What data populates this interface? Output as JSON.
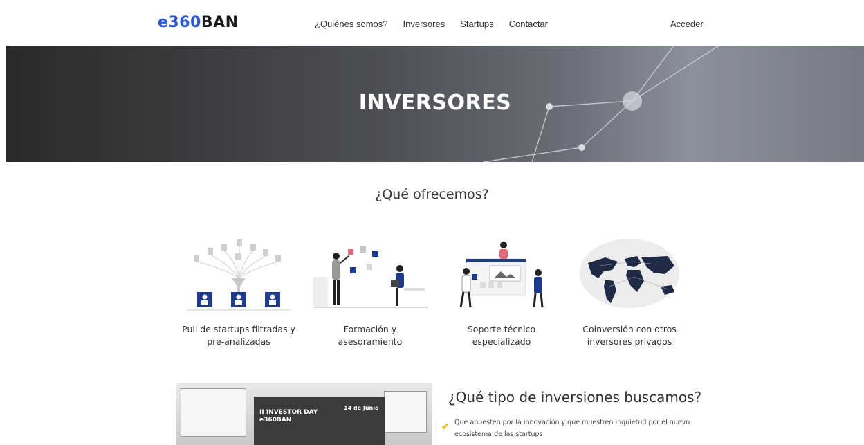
{
  "header": {
    "logo_part1": "e360",
    "logo_part2": "BAN",
    "nav": [
      "¿Quiénes somos?",
      "Inversores",
      "Startups",
      "Contactar"
    ],
    "login": "Acceder"
  },
  "hero": {
    "title": "INVERSORES"
  },
  "offer": {
    "title": "¿Qué ofrecemos?",
    "features": [
      {
        "caption_line1": "Pull de startups filtradas y",
        "caption_line2": "pre-analizadas",
        "icon": "startup-funnel-icon"
      },
      {
        "caption_line1": "Formación y",
        "caption_line2": "asesoramiento",
        "icon": "training-icon"
      },
      {
        "caption_line1": "Soporte técnico",
        "caption_line2": "especializado",
        "icon": "support-icon"
      },
      {
        "caption_line1": "Coinversión con otros",
        "caption_line2": "inversores privados",
        "icon": "world-map-icon"
      }
    ]
  },
  "investments": {
    "title": "¿Qué tipo de inversiones buscamos?",
    "items": [
      "Que apuesten por la innovación y que muestren inquietud por el nuevo ecosistema de las startups"
    ],
    "event_title_line1": "II INVESTOR DAY",
    "event_title_line2": "e360BAN",
    "event_date": "14 de Junio"
  },
  "colors": {
    "brand": "#2a5bd7",
    "accent": "#f1b51c",
    "icon_blue": "#1f3a8a"
  }
}
